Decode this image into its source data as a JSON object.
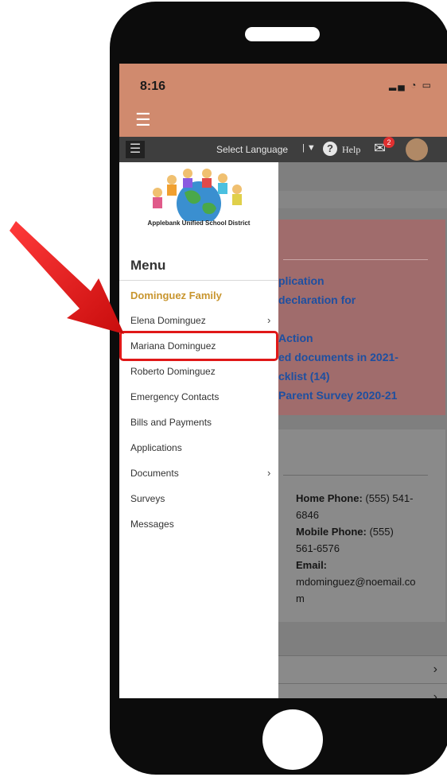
{
  "status": {
    "time": "8:16",
    "icons": "▂▄ ◔ ▭"
  },
  "app_menu_icon": "hamburger-icon",
  "toolbar": {
    "menu_icon": "☰",
    "select_language": "Select Language",
    "lang_caret": "| ▼",
    "help_icon": "?",
    "help": "Help",
    "mail_icon": "✉",
    "mail_badge": "2"
  },
  "drawer": {
    "district": "Applebank Unified School District",
    "menu_title": "Menu",
    "family": "Dominguez Family",
    "items": [
      "Elena Dominguez",
      "Mariana Dominguez",
      "Roberto Dominguez",
      "Emergency Contacts",
      "Bills and Payments",
      "Applications",
      "Documents",
      "Surveys",
      "Messages"
    ],
    "chevron": "›"
  },
  "background": {
    "card1": [
      "plication",
      "declaration for",
      "Action",
      "ed documents in 2021-",
      "cklist (14)",
      "Parent Survey 2020-21"
    ],
    "card2": {
      "home_label": "Home Phone:",
      "home_value": "(555) 541-",
      "home_value2": "6846",
      "mobile_label": "Mobile Phone:",
      "mobile_value": "(555)",
      "mobile_value2": "561-6576",
      "email_label": "Email:",
      "email_value": "mdominguez@noemail.co",
      "email_value2": "m"
    },
    "row_chevron": "›"
  },
  "colors": {
    "highlight": "#e01818",
    "arrow": "#e01818",
    "family_accent": "#c8952e",
    "status_bar": "#d08a6e"
  }
}
